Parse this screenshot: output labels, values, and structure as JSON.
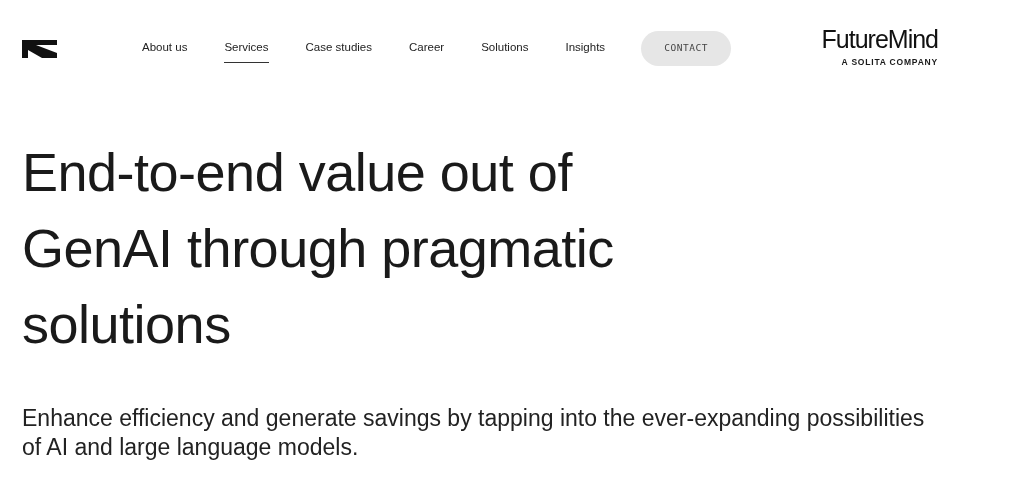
{
  "nav": {
    "items": [
      {
        "label": "About us",
        "selected": false
      },
      {
        "label": "Services",
        "selected": true
      },
      {
        "label": "Case studies",
        "selected": false
      },
      {
        "label": "Career",
        "selected": false
      },
      {
        "label": "Solutions",
        "selected": false
      },
      {
        "label": "Insights",
        "selected": false
      }
    ],
    "contact_button": "CONTACT"
  },
  "brand": {
    "name": "FutureMind",
    "tagline": "A SOLITA COMPANY"
  },
  "hero": {
    "heading": "End-to-end value out of GenAI through pragmatic solutions",
    "description": "Enhance efficiency and generate savings by tapping into the ever-expanding possibilities of AI and large language models."
  }
}
